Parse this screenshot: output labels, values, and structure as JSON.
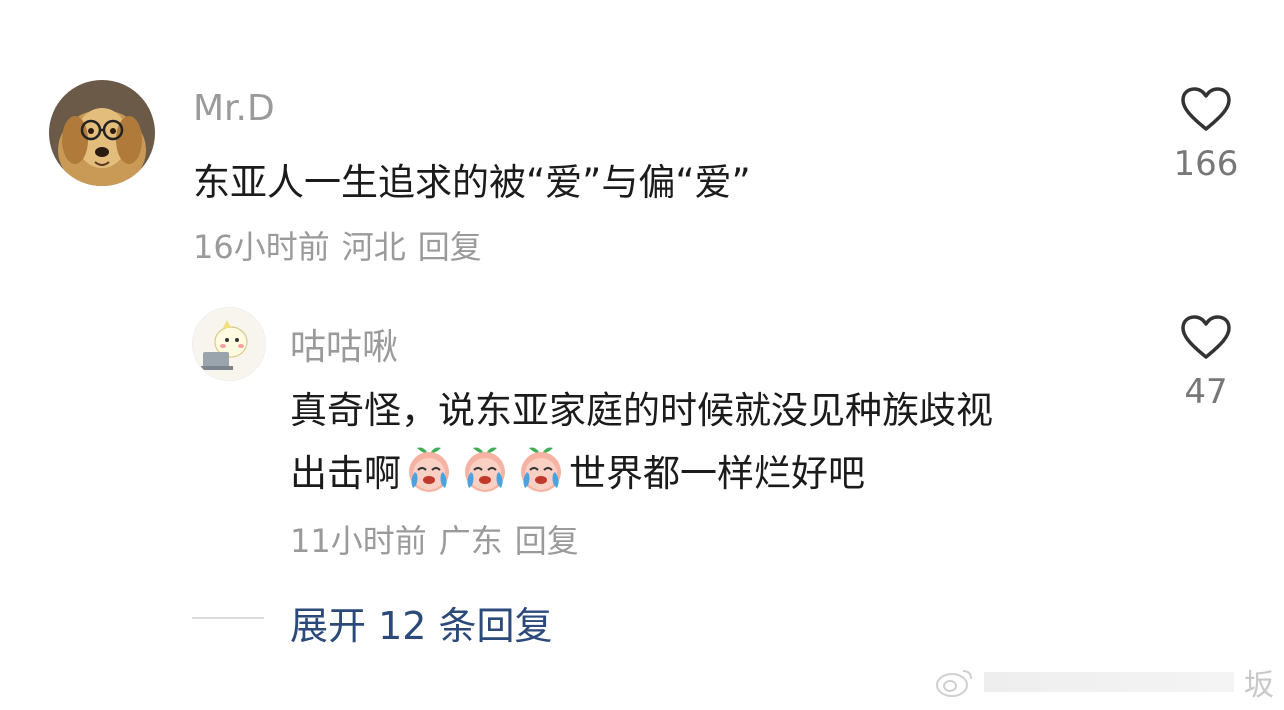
{
  "comments": [
    {
      "username": "Mr.D",
      "text": "东亚人一生追求的被“爱”与偏“爱”",
      "time": "16小时前",
      "location": "河北",
      "reply_label": "回复",
      "likes": "166",
      "avatar": "golden-retriever-with-glasses"
    },
    {
      "username": "咕咕啾",
      "text_line1": "真奇怪，说东亚家庭的时候就没见种族歧视",
      "text_line2_before": "出击啊",
      "text_line2_after": "世界都一样烂好吧",
      "emoji": "crying-peach-emoji",
      "time": "11小时前",
      "location": "广东",
      "reply_label": "回复",
      "likes": "47",
      "avatar": "cartoon-bird-at-laptop"
    }
  ],
  "expand_replies": "展开 12 条回复",
  "watermark": "坂",
  "colors": {
    "muted": "#9a9a9a",
    "text": "#1b1b1b",
    "link": "#2b4a7a"
  }
}
